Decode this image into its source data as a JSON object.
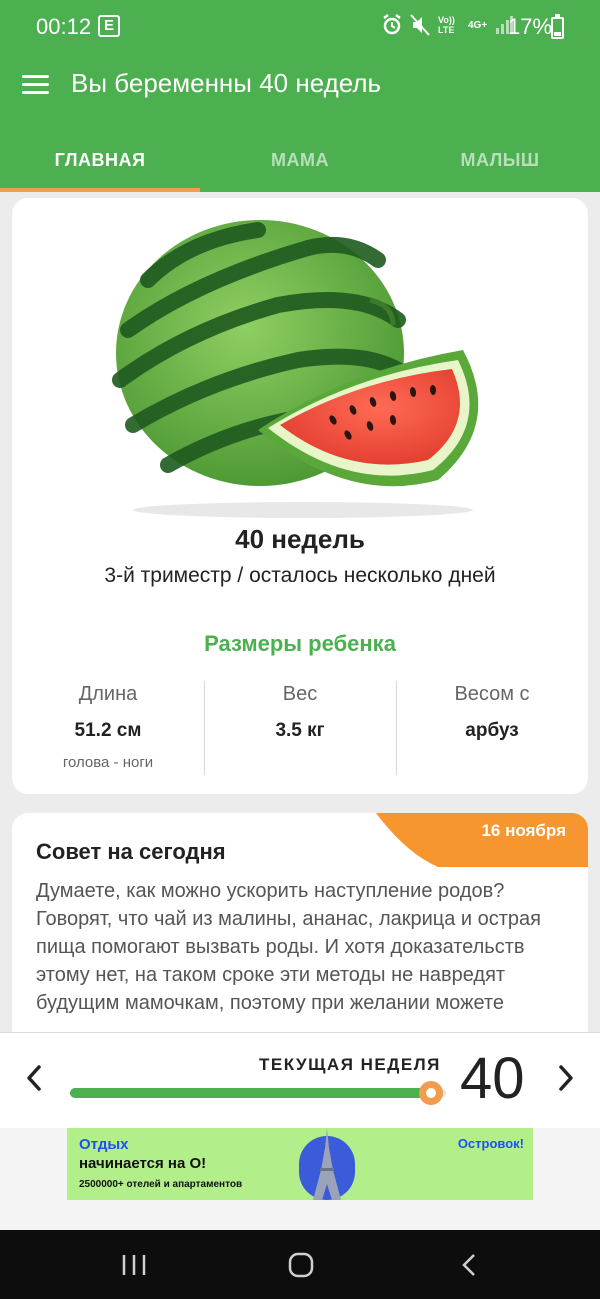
{
  "status": {
    "time": "00:12",
    "notif_letter": "E",
    "net_labels": [
      "Vo)) LTE",
      "4G+"
    ],
    "battery": "17%"
  },
  "appbar": {
    "title": "Вы беременны 40 недель"
  },
  "tabs": [
    {
      "label": "ГЛАВНАЯ",
      "active": true
    },
    {
      "label": "МАМА",
      "active": false
    },
    {
      "label": "МАЛЫШ",
      "active": false
    }
  ],
  "week_card": {
    "image": "watermelon",
    "title": "40 недель",
    "subtitle": "3-й триместр / осталось несколько дней",
    "sizes_title": "Размеры ребенка",
    "stats": [
      {
        "label": "Длина",
        "value": "51.2 см",
        "note": "голова - ноги"
      },
      {
        "label": "Вес",
        "value": "3.5 кг"
      },
      {
        "label": "Весом с",
        "value": "арбуз"
      }
    ]
  },
  "tip": {
    "date": "16 ноября",
    "title": "Совет на сегодня",
    "text": "Думаете, как можно ускорить наступление родов? Говорят, что чай из малины, ананас, лакрица и острая пища помогают вызвать роды. И хотя доказательств этому нет, на таком сроке эти методы не навредят будущим мамочкам, поэтому при желании можете"
  },
  "week_selector": {
    "label": "ТЕКУЩАЯ НЕДЕЛЯ",
    "week": "40",
    "progress": 0.96
  },
  "ad": {
    "line1": "Отдых",
    "line2": "начинается на О!",
    "line3": "2500000+ отелей и апартаментов",
    "brand": "Островок!"
  },
  "colors": {
    "primary": "#4caf50",
    "accent": "#f39c4f",
    "ad_bg": "#b2ef8a"
  }
}
